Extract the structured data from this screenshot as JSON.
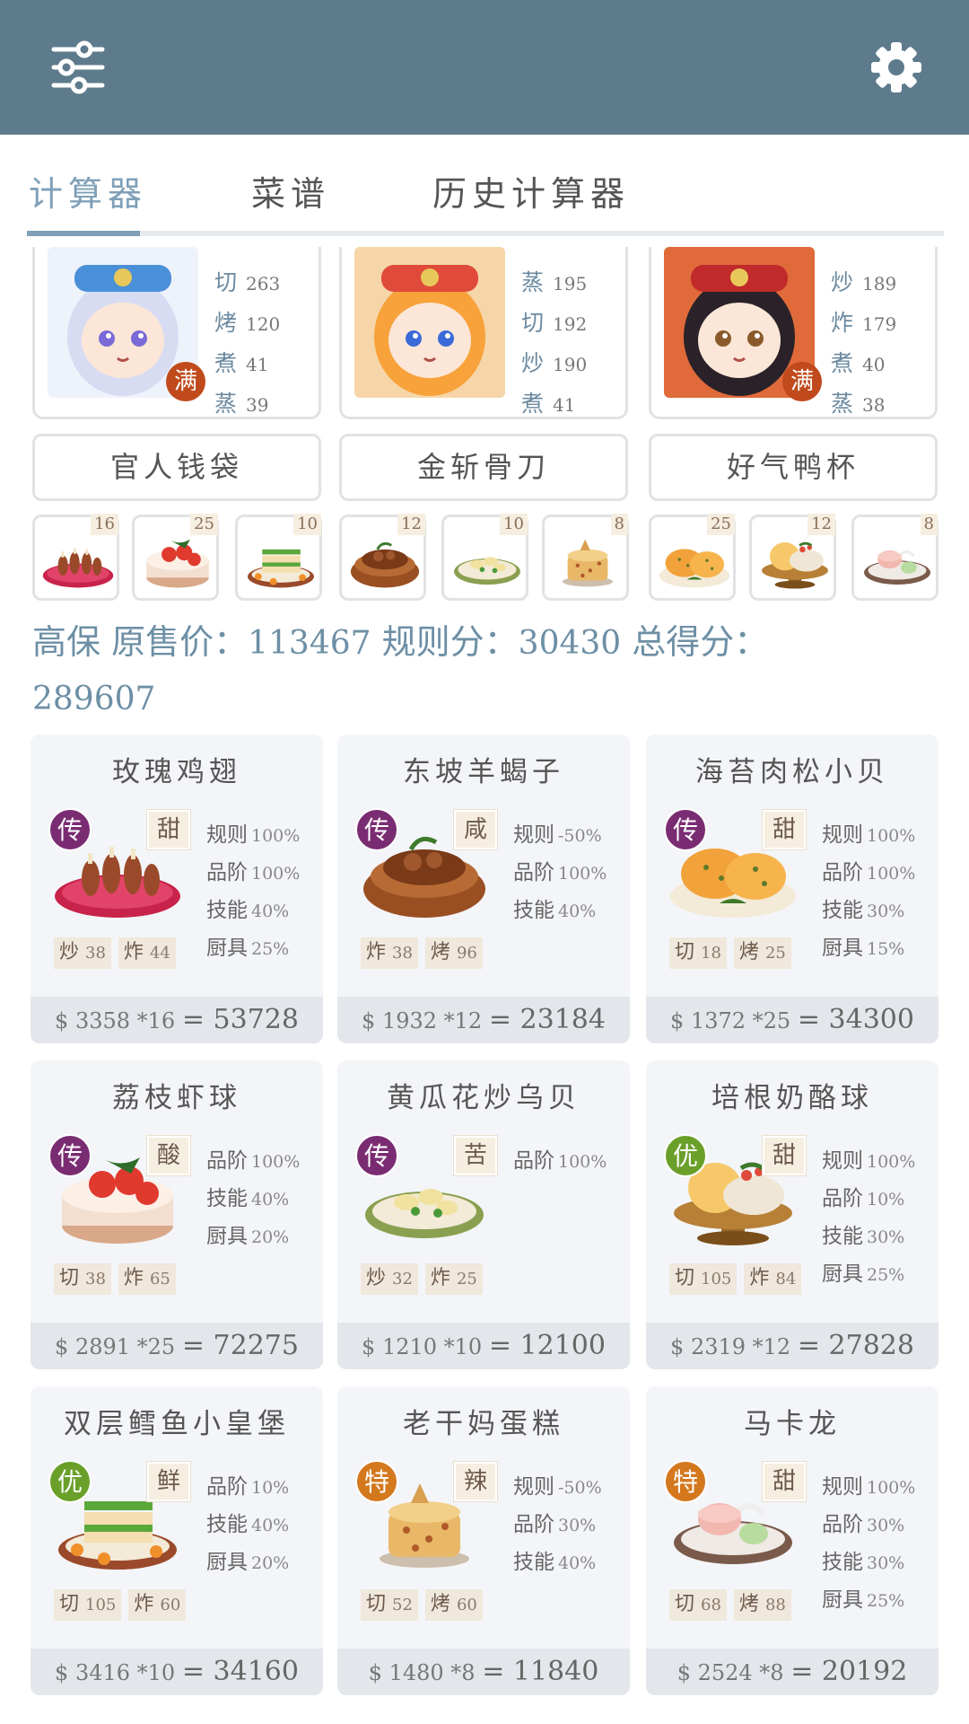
{
  "topbar": {
    "menu_icon": "sliders-icon",
    "settings_icon": "gear-icon",
    "color": "#5e7b8d"
  },
  "tabs": [
    {
      "label": "计算器",
      "active": true
    },
    {
      "label": "菜谱",
      "active": false
    },
    {
      "label": "历史计算器",
      "active": false
    }
  ],
  "chefs": [
    {
      "full_badge": "满",
      "skills": [
        {
          "name": "切",
          "value": "263"
        },
        {
          "name": "烤",
          "value": "120"
        },
        {
          "name": "煮",
          "value": "41"
        },
        {
          "name": "蒸",
          "value": "39"
        }
      ]
    },
    {
      "full_badge": "",
      "skills": [
        {
          "name": "蒸",
          "value": "195"
        },
        {
          "name": "切",
          "value": "192"
        },
        {
          "name": "炒",
          "value": "190"
        },
        {
          "name": "煮",
          "value": "41"
        }
      ]
    },
    {
      "full_badge": "满",
      "skills": [
        {
          "name": "炒",
          "value": "189"
        },
        {
          "name": "炸",
          "value": "179"
        },
        {
          "name": "煮",
          "value": "40"
        },
        {
          "name": "蒸",
          "value": "38"
        }
      ]
    }
  ],
  "equipment": [
    "官人钱袋",
    "金斩骨刀",
    "好气鸭杯"
  ],
  "mini_dishes": [
    {
      "count": "16",
      "icon": "rose-chicken-wings-icon"
    },
    {
      "count": "25",
      "icon": "lychee-shrimp-icon"
    },
    {
      "count": "10",
      "icon": "cod-burger-icon"
    },
    {
      "count": "12",
      "icon": "dongpo-lamb-icon"
    },
    {
      "count": "10",
      "icon": "cucumber-clam-icon"
    },
    {
      "count": "8",
      "icon": "laoganma-cake-icon"
    },
    {
      "count": "25",
      "icon": "seaweed-scallop-icon"
    },
    {
      "count": "12",
      "icon": "bacon-cheese-ball-icon"
    },
    {
      "count": "8",
      "icon": "macaron-icon"
    }
  ],
  "summary": {
    "prefix": "高保",
    "orig_label": "原售价：",
    "orig_value": "113467",
    "rule_label": "规则分：",
    "rule_value": "30430",
    "total_label": "总得分：",
    "total_value": "289607"
  },
  "dishes": [
    {
      "name": "玫瑰鸡翅",
      "rarity": "传",
      "rarity_class": "r-legend",
      "taste": "甜",
      "img": "chicken",
      "stats": [
        {
          "k": "规则",
          "v": "100%"
        },
        {
          "k": "品阶",
          "v": "100%"
        },
        {
          "k": "技能",
          "v": "40%"
        },
        {
          "k": "厨具",
          "v": "25%"
        }
      ],
      "reqs": [
        {
          "k": "炒",
          "v": "38"
        },
        {
          "k": "炸",
          "v": "44"
        }
      ],
      "price": "$ 3358 *16",
      "total": "= 53728"
    },
    {
      "name": "东坡羊蝎子",
      "rarity": "传",
      "rarity_class": "r-legend",
      "taste": "咸",
      "img": "pot",
      "stats": [
        {
          "k": "规则",
          "v": "-50%"
        },
        {
          "k": "品阶",
          "v": "100%"
        },
        {
          "k": "技能",
          "v": "40%"
        }
      ],
      "reqs": [
        {
          "k": "炸",
          "v": "38"
        },
        {
          "k": "烤",
          "v": "96"
        }
      ],
      "price": "$ 1932 *12",
      "total": "= 23184"
    },
    {
      "name": "海苔肉松小贝",
      "rarity": "传",
      "rarity_class": "r-legend",
      "taste": "甜",
      "img": "buns",
      "stats": [
        {
          "k": "规则",
          "v": "100%"
        },
        {
          "k": "品阶",
          "v": "100%"
        },
        {
          "k": "技能",
          "v": "30%"
        },
        {
          "k": "厨具",
          "v": "15%"
        }
      ],
      "reqs": [
        {
          "k": "切",
          "v": "18"
        },
        {
          "k": "烤",
          "v": "25"
        }
      ],
      "price": "$ 1372 *25",
      "total": "= 34300"
    },
    {
      "name": "荔枝虾球",
      "rarity": "传",
      "rarity_class": "r-legend",
      "taste": "酸",
      "img": "lychee",
      "stats": [
        {
          "k": "品阶",
          "v": "100%"
        },
        {
          "k": "技能",
          "v": "40%"
        },
        {
          "k": "厨具",
          "v": "20%"
        }
      ],
      "reqs": [
        {
          "k": "切",
          "v": "38"
        },
        {
          "k": "炸",
          "v": "65"
        }
      ],
      "price": "$ 2891 *25",
      "total": "= 72275"
    },
    {
      "name": "黄瓜花炒乌贝",
      "rarity": "传",
      "rarity_class": "r-legend",
      "taste": "苦",
      "img": "plate",
      "stats": [
        {
          "k": "品阶",
          "v": "100%"
        }
      ],
      "reqs": [
        {
          "k": "炒",
          "v": "32"
        },
        {
          "k": "炸",
          "v": "25"
        }
      ],
      "price": "$ 1210 *10",
      "total": "= 12100"
    },
    {
      "name": "培根奶酪球",
      "rarity": "优",
      "rarity_class": "r-good",
      "taste": "甜",
      "img": "stand",
      "stats": [
        {
          "k": "规则",
          "v": "100%"
        },
        {
          "k": "品阶",
          "v": "10%"
        },
        {
          "k": "技能",
          "v": "30%"
        },
        {
          "k": "厨具",
          "v": "25%"
        }
      ],
      "reqs": [
        {
          "k": "切",
          "v": "105"
        },
        {
          "k": "炸",
          "v": "84"
        }
      ],
      "price": "$ 2319 *12",
      "total": "= 27828"
    },
    {
      "name": "双层鳕鱼小皇堡",
      "rarity": "优",
      "rarity_class": "r-good",
      "taste": "鲜",
      "img": "burger",
      "stats": [
        {
          "k": "品阶",
          "v": "10%"
        },
        {
          "k": "技能",
          "v": "40%"
        },
        {
          "k": "厨具",
          "v": "20%"
        }
      ],
      "reqs": [
        {
          "k": "切",
          "v": "105"
        },
        {
          "k": "炸",
          "v": "60"
        }
      ],
      "price": "$ 3416 *10",
      "total": "= 34160"
    },
    {
      "name": "老干妈蛋糕",
      "rarity": "特",
      "rarity_class": "r-special",
      "taste": "辣",
      "img": "cake",
      "stats": [
        {
          "k": "规则",
          "v": "-50%"
        },
        {
          "k": "品阶",
          "v": "30%"
        },
        {
          "k": "技能",
          "v": "40%"
        }
      ],
      "reqs": [
        {
          "k": "切",
          "v": "52"
        },
        {
          "k": "烤",
          "v": "60"
        }
      ],
      "price": "$ 1480 *8",
      "total": "= 11840"
    },
    {
      "name": "马卡龙",
      "rarity": "特",
      "rarity_class": "r-special",
      "taste": "甜",
      "img": "macaron",
      "stats": [
        {
          "k": "规则",
          "v": "100%"
        },
        {
          "k": "品阶",
          "v": "30%"
        },
        {
          "k": "技能",
          "v": "30%"
        },
        {
          "k": "厨具",
          "v": "25%"
        }
      ],
      "reqs": [
        {
          "k": "切",
          "v": "68"
        },
        {
          "k": "烤",
          "v": "88"
        }
      ],
      "price": "$ 2524 *8",
      "total": "= 20192"
    }
  ]
}
